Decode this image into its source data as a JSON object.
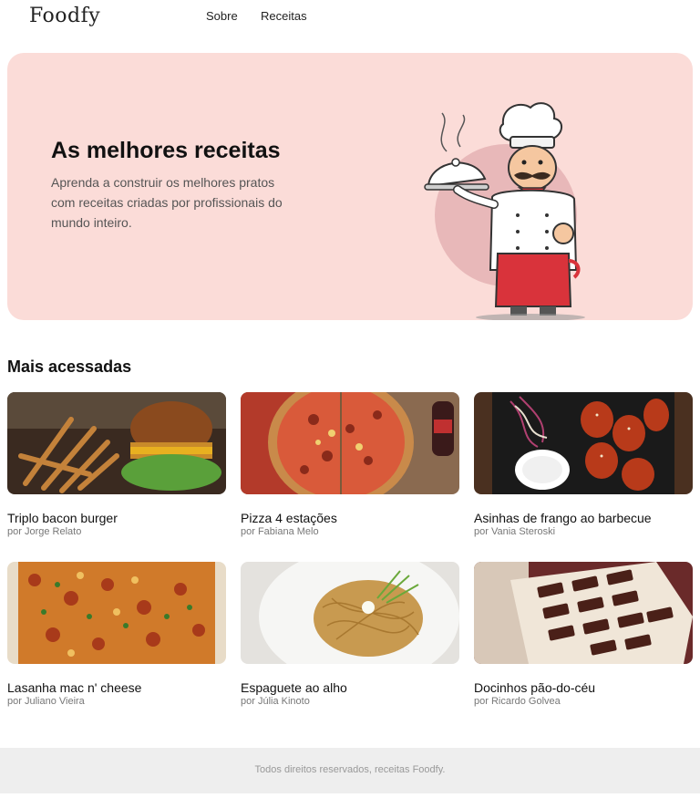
{
  "header": {
    "logo": "Foodfy",
    "nav": {
      "about": "Sobre",
      "recipes": "Receitas"
    }
  },
  "hero": {
    "title": "As melhores receitas",
    "text": "Aprenda a construir os melhores pratos com receitas criadas por profissionais do mundo inteiro.",
    "illustration": "chef-illustration"
  },
  "section": {
    "title": "Mais acessadas"
  },
  "recipes": [
    {
      "title": "Triplo bacon burger",
      "author": "por Jorge Relato",
      "image": "burger-photo"
    },
    {
      "title": "Pizza 4 estações",
      "author": "por Fabiana Melo",
      "image": "pizza-photo"
    },
    {
      "title": "Asinhas de frango ao barbecue",
      "author": "por Vania Steroski",
      "image": "chicken-wings-photo"
    },
    {
      "title": "Lasanha mac n' cheese",
      "author": "por Juliano Vieira",
      "image": "lasagna-photo"
    },
    {
      "title": "Espaguete ao alho",
      "author": "por Júlia Kinoto",
      "image": "spaghetti-photo"
    },
    {
      "title": "Docinhos pão-do-céu",
      "author": "por Ricardo Golvea",
      "image": "chocolates-photo"
    }
  ],
  "footer": {
    "text": "Todos direitos reservados, receitas Foodfy."
  },
  "colors": {
    "hero_bg": "#fbdcd8",
    "footer_bg": "#eeeeee",
    "apron": "#d9333b"
  }
}
